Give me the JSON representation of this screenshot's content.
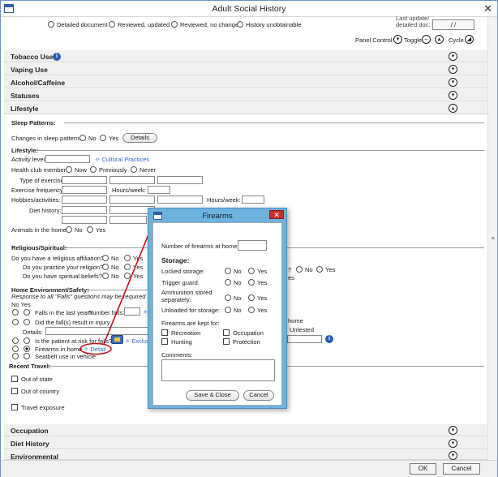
{
  "window": {
    "title": "Adult Social History",
    "close_glyph": "✕"
  },
  "top": {
    "radios": [
      "Detailed document",
      "Reviewed, updated",
      "Reviewed, no change",
      "History unobtainable"
    ],
    "last_update_label_1": "Last update/",
    "last_update_label_2": "detailed doc:",
    "last_update_value": "/ /",
    "panel_control_label": "Panel Control:",
    "toggle_label": "Toggle",
    "cycle_label": "Cycle"
  },
  "sections_top": [
    {
      "label": "Tobacco Use",
      "info": "i"
    },
    {
      "label": "Vaping Use"
    },
    {
      "label": "Alcohol/Caffeine"
    },
    {
      "label": "Statuses"
    },
    {
      "label": "Lifestyle"
    }
  ],
  "lifestyle": {
    "sleep_header": "Sleep Patterns:",
    "sleep_changes": "Changes in sleep patterns:",
    "no": "No",
    "yes": "Yes",
    "details_button": "Details",
    "lifestyle_header": "Lifestyle:",
    "activity_level": "Activity level:",
    "cultural_practices": "✧ Cultural Practices",
    "health_club": "Health club member:",
    "now": "Now",
    "previously": "Previously",
    "never": "Never",
    "type_of_exercise": "Type of exercise:",
    "exercise_frequency": "Exercise frequency:",
    "hours_week": "Hours/week:",
    "hobbies": "Hobbies/activities:",
    "diet_history": "Diet history:",
    "animals": "Animals in the home:"
  },
  "religious": {
    "header": "Religious/Spiritual:",
    "q1": "Do you have a religious affiliation?",
    "q2": "Do you practice your religion?",
    "q3": "Do you have spiritual beliefs?",
    "no": "No",
    "yes": "Yes",
    "q_mark": "?"
  },
  "home": {
    "header": "Home Environment/Safety:",
    "note": "Response to all \"Falls\" questions may be required for Quality",
    "no_yes": "No  Yes",
    "falls_last_year": "Falls in the last year?",
    "number_falls": "Number falls:",
    "falls_injury": "Did the fall(s) result in injury",
    "details": "Details:",
    "home_fragment": "home",
    "untested": "Untested",
    "risk_falls": "Is the patient at risk for falls?",
    "exclusion": "✧ Exclusion",
    "firearms": "Firearms in home",
    "detail_link": "✧ Detail",
    "seatbelt": "Seatbelt use in vehicle"
  },
  "recent_travel": {
    "header": "Recent Travel:",
    "out_of_state": "Out of state",
    "out_of_country": "Out of country",
    "travel_exposure": "Travel exposure"
  },
  "sections_bottom": [
    {
      "label": "Occupation"
    },
    {
      "label": "Diet History"
    },
    {
      "label": "Environmental"
    }
  ],
  "modal": {
    "title": "Firearms",
    "close_glyph": "✕",
    "num_firearms": "Number of firearms at home:",
    "storage_header": "Storage:",
    "rows": [
      {
        "label": "Locked storage:"
      },
      {
        "label": "Trigger guard:"
      },
      {
        "label": "Ammunition stored",
        "label2": "separately:"
      },
      {
        "label": "Unloaded for storage:"
      }
    ],
    "no": "No",
    "yes": "Yes",
    "kept_for": "Firearms are kept for:",
    "purposes": [
      "Recreation",
      "Occupation",
      "Hunting",
      "Protection"
    ],
    "comments": "Comments:",
    "save_close": "Save & Close",
    "cancel": "Cancel"
  },
  "footer": {
    "ok": "OK",
    "cancel": "Cancel"
  },
  "colors": {
    "accent_link": "#3366cc",
    "modal_frame": "#6db2dd",
    "annotation_red": "#c0141c"
  }
}
